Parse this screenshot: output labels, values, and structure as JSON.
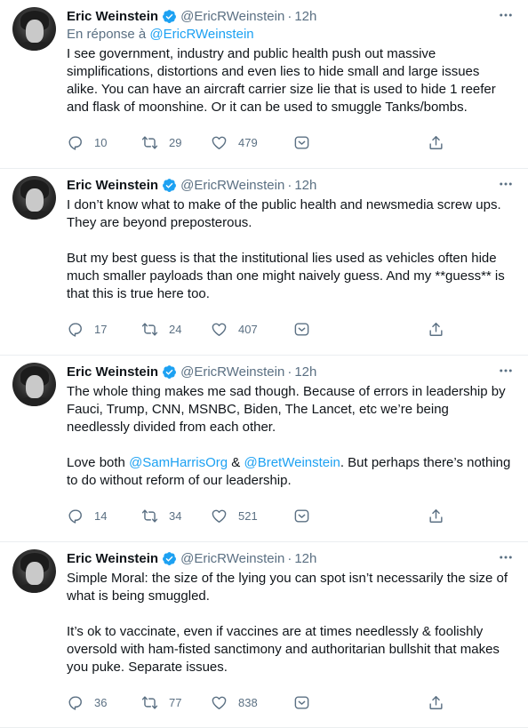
{
  "author": {
    "name": "Eric Weinstein",
    "handle": "@EricRWeinstein",
    "time": "12h",
    "separator": "·"
  },
  "reply_prefix": "En réponse à ",
  "reply_handle": "@EricRWeinstein",
  "colors": {
    "accent": "#1da1f2",
    "secondary_text": "#5b7083",
    "primary_text": "#0f1419"
  },
  "icons": [
    "verified-badge-icon",
    "more-options-icon",
    "reply-icon",
    "retweet-icon",
    "like-icon",
    "download-icon",
    "share-icon"
  ],
  "tweets": [
    {
      "p1": "I see government, industry and public health push out massive simplifications, distortions and even lies to hide small and large issues alike. You can have an aircraft carrier size lie that is used to hide 1 reefer and flask of moonshine. Or it can be used to smuggle Tanks/bombs.",
      "replies": "10",
      "retweets": "29",
      "likes": "479"
    },
    {
      "p1": "I don’t know what to make of the public health and newsmedia screw ups. They are beyond preposterous.",
      "p2": "But my best guess is that the institutional lies used as vehicles often hide much smaller payloads than one might naively guess. And my **guess** is that this is true here too.",
      "replies": "17",
      "retweets": "24",
      "likes": "407"
    },
    {
      "p1": "The whole thing makes me sad though. Because of errors in leadership by Fauci, Trump, CNN, MSNBC, Biden, The Lancet, etc we’re being needlessly divided from each other.",
      "p2_a": "Love both ",
      "p2_m1": "@SamHarrisOrg",
      "p2_b": " & ",
      "p2_m2": "@BretWeinstein",
      "p2_c": ". But perhaps there’s nothing to do without reform of our leadership.",
      "replies": "14",
      "retweets": "34",
      "likes": "521"
    },
    {
      "p1": "Simple Moral: the size of the lying you can spot isn’t necessarily the size of what is being smuggled.",
      "p2": "It’s ok to vaccinate, even if  vaccines are at times needlessly & foolishly oversold with ham-fisted sanctimony and authoritarian bullshit that makes you puke. Separate issues.",
      "replies": "36",
      "retweets": "77",
      "likes": "838"
    }
  ]
}
